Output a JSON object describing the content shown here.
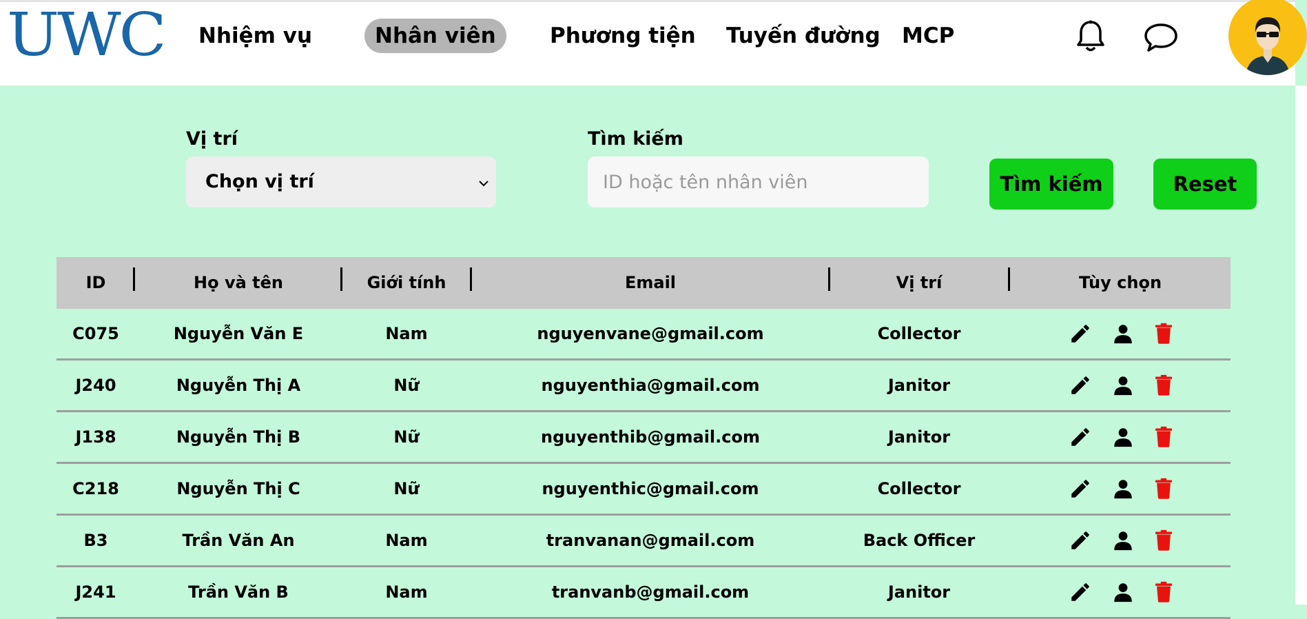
{
  "header": {
    "logo": "UWC",
    "nav": [
      {
        "label": "Nhiệm vụ",
        "active": false
      },
      {
        "label": "Nhân viên",
        "active": true
      },
      {
        "label": "Phương tiện",
        "active": false
      },
      {
        "label": "Tuyến đường",
        "active": false
      },
      {
        "label": "MCP",
        "active": false
      }
    ],
    "icons": [
      "bell-icon",
      "chat-icon"
    ]
  },
  "filters": {
    "position_label": "Vị trí",
    "position_select_value": "Chọn vị trí",
    "search_label": "Tìm kiếm",
    "search_placeholder": "ID hoặc tên nhân viên",
    "search_value": "",
    "search_button": "Tìm kiếm",
    "reset_button": "Reset"
  },
  "table": {
    "headers": [
      "ID",
      "Họ và tên",
      "Giới tính",
      "Email",
      "Vị trí",
      "Tùy chọn"
    ],
    "rows": [
      {
        "id": "C075",
        "name": "Nguyễn Văn E",
        "gender": "Nam",
        "email": "nguyenvane@gmail.com",
        "position": "Collector"
      },
      {
        "id": "J240",
        "name": "Nguyễn Thị A",
        "gender": "Nữ",
        "email": "nguyenthia@gmail.com",
        "position": "Janitor"
      },
      {
        "id": "J138",
        "name": "Nguyễn Thị B",
        "gender": "Nữ",
        "email": "nguyenthib@gmail.com",
        "position": "Janitor"
      },
      {
        "id": "C218",
        "name": "Nguyễn Thị C",
        "gender": "Nữ",
        "email": "nguyenthic@gmail.com",
        "position": "Collector"
      },
      {
        "id": "B3",
        "name": "Trần Văn An",
        "gender": "Nam",
        "email": "tranvanan@gmail.com",
        "position": "Back Officer"
      },
      {
        "id": "J241",
        "name": "Trần Văn B",
        "gender": "Nam",
        "email": "tranvanb@gmail.com",
        "position": "Janitor"
      }
    ],
    "row_actions": [
      "edit-icon",
      "user-icon",
      "trash-icon"
    ]
  },
  "colors": {
    "page_bg": "#c3f8da",
    "logo": "#1a66a8",
    "button_green": "#0fcf18",
    "active_nav": "#b5b5b5",
    "table_header": "#c8c8c8",
    "delete_red": "#e8130f",
    "avatar_bg": "#f9bf13"
  }
}
